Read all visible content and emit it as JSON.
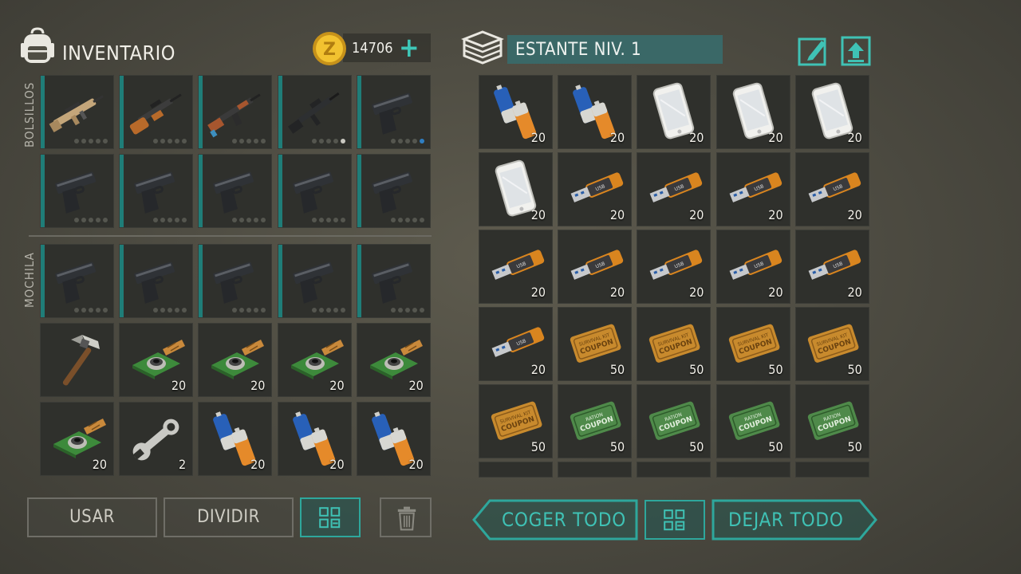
{
  "inventory": {
    "title": "INVENTARIO",
    "coins": "14706",
    "pockets_label": "BOLSILLOS",
    "backpack_label": "MOCHILA",
    "pockets": [
      {
        "item": "scar-rifle-icon",
        "qty": "",
        "dots": "grey"
      },
      {
        "item": "smg-rifle-icon",
        "qty": "",
        "dots": "grey"
      },
      {
        "item": "ak-rifle-icon",
        "qty": "",
        "dots": "grey"
      },
      {
        "item": "m16-rifle-icon",
        "qty": "",
        "dots": "white"
      },
      {
        "item": "pistol-icon",
        "qty": "",
        "dots": "blue"
      },
      {
        "item": "pistol-icon",
        "qty": "",
        "dots": "grey"
      },
      {
        "item": "pistol-icon",
        "qty": "",
        "dots": "grey"
      },
      {
        "item": "pistol-icon",
        "qty": "",
        "dots": "grey"
      },
      {
        "item": "pistol-icon",
        "qty": "",
        "dots": "grey"
      },
      {
        "item": "pistol-icon",
        "qty": "",
        "dots": "grey"
      }
    ],
    "backpack": [
      {
        "item": "pistol-icon",
        "qty": "",
        "dots": "grey"
      },
      {
        "item": "pistol-icon",
        "qty": "",
        "dots": "grey"
      },
      {
        "item": "pistol-icon",
        "qty": "",
        "dots": "grey"
      },
      {
        "item": "pistol-icon",
        "qty": "",
        "dots": "grey"
      },
      {
        "item": "pistol-icon",
        "qty": "",
        "dots": "grey"
      },
      {
        "item": "pickaxe-icon",
        "qty": "",
        "dots": "none"
      },
      {
        "item": "camera-module-icon",
        "qty": "20",
        "dots": "none"
      },
      {
        "item": "camera-module-icon",
        "qty": "20",
        "dots": "none"
      },
      {
        "item": "camera-module-icon",
        "qty": "20",
        "dots": "none"
      },
      {
        "item": "camera-module-icon",
        "qty": "20",
        "dots": "none"
      },
      {
        "item": "camera-module-icon",
        "qty": "20",
        "dots": "none"
      },
      {
        "item": "wrench-icon",
        "qty": "2",
        "dots": "none"
      },
      {
        "item": "batteries-icon",
        "qty": "20",
        "dots": "none"
      },
      {
        "item": "batteries-icon",
        "qty": "20",
        "dots": "none"
      },
      {
        "item": "batteries-icon",
        "qty": "20",
        "dots": "none"
      }
    ],
    "buttons": {
      "use": "USAR",
      "split": "DIVIDIR"
    }
  },
  "shelf": {
    "title": "ESTANTE NIV. 1",
    "items": [
      {
        "item": "batteries-icon",
        "qty": "20"
      },
      {
        "item": "batteries-icon",
        "qty": "20"
      },
      {
        "item": "smartphone-icon",
        "qty": "20"
      },
      {
        "item": "smartphone-icon",
        "qty": "20"
      },
      {
        "item": "smartphone-icon",
        "qty": "20"
      },
      {
        "item": "smartphone-icon",
        "qty": "20"
      },
      {
        "item": "usb-drive-icon",
        "qty": "20"
      },
      {
        "item": "usb-drive-icon",
        "qty": "20"
      },
      {
        "item": "usb-drive-icon",
        "qty": "20"
      },
      {
        "item": "usb-drive-icon",
        "qty": "20"
      },
      {
        "item": "usb-drive-icon",
        "qty": "20"
      },
      {
        "item": "usb-drive-icon",
        "qty": "20"
      },
      {
        "item": "usb-drive-icon",
        "qty": "20"
      },
      {
        "item": "usb-drive-icon",
        "qty": "20"
      },
      {
        "item": "usb-drive-icon",
        "qty": "20"
      },
      {
        "item": "usb-drive-icon",
        "qty": "20"
      },
      {
        "item": "survival-coupon-icon",
        "qty": "50"
      },
      {
        "item": "survival-coupon-icon",
        "qty": "50"
      },
      {
        "item": "survival-coupon-icon",
        "qty": "50"
      },
      {
        "item": "survival-coupon-icon",
        "qty": "50"
      },
      {
        "item": "survival-coupon-icon",
        "qty": "50"
      },
      {
        "item": "ration-coupon-icon",
        "qty": "50"
      },
      {
        "item": "ration-coupon-icon",
        "qty": "50"
      },
      {
        "item": "ration-coupon-icon",
        "qty": "50"
      },
      {
        "item": "ration-coupon-icon",
        "qty": "50"
      }
    ],
    "buttons": {
      "take_all": "COGER TODO",
      "drop_all": "DEJAR TODO"
    }
  },
  "colors": {
    "accent": "#3fc2b5",
    "teal_bar": "#1f7d78",
    "slot_bg": "#2f302c",
    "title_box": "#3a6867"
  }
}
